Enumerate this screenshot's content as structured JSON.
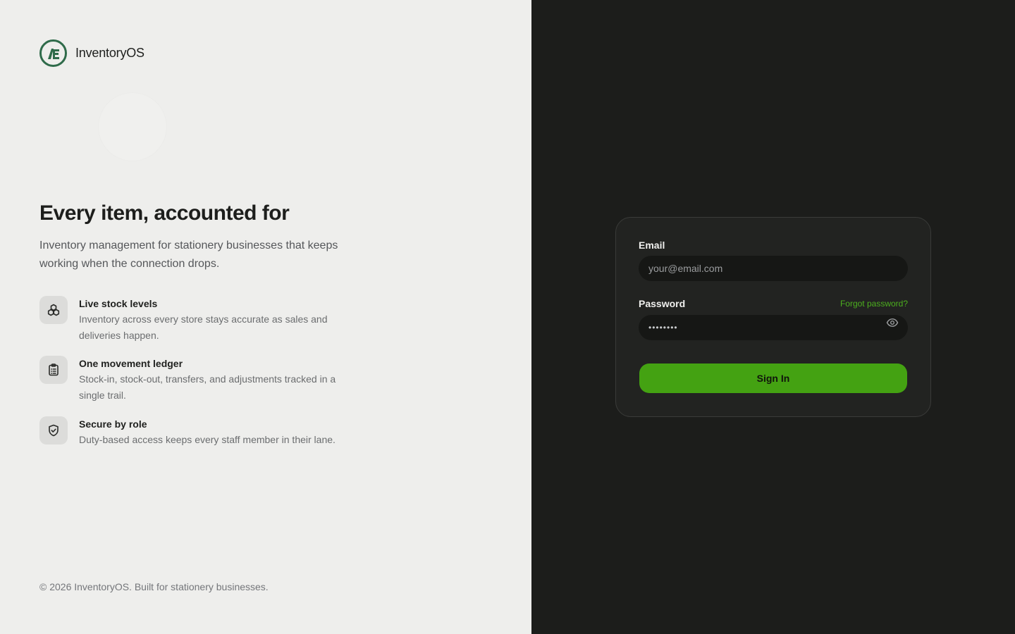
{
  "brand": {
    "name": "InventoryOS",
    "logo_icon": "inventory-logo-icon"
  },
  "hero": {
    "title": "Every item, accounted for",
    "subtitle": "Inventory management for stationery businesses that keeps working when the connection drops."
  },
  "features": [
    {
      "icon": "cubes-icon",
      "title": "Live stock levels",
      "description": "Inventory across every store stays accurate as sales and deliveries happen."
    },
    {
      "icon": "clipboard-icon",
      "title": "One movement ledger",
      "description": "Stock-in, stock-out, transfers, and adjustments tracked in a single trail."
    },
    {
      "icon": "shield-check-icon",
      "title": "Secure by role",
      "description": "Duty-based access keeps every staff member in their lane."
    }
  ],
  "footer": {
    "text": "© 2026 InventoryOS. Built for stationery businesses."
  },
  "login": {
    "email_label": "Email",
    "email_placeholder": "your@email.com",
    "email_value": "",
    "password_label": "Password",
    "password_value": "••••••••",
    "forgot_label": "Forgot password?",
    "show_password_icon": "eye-icon",
    "submit_label": "Sign In"
  },
  "colors": {
    "left_bg": "#eeeeec",
    "right_bg": "#1c1d1b",
    "card_bg": "#222321",
    "accent": "#44a212",
    "link": "#4caf1e",
    "logo_green": "#2f6b4a"
  }
}
